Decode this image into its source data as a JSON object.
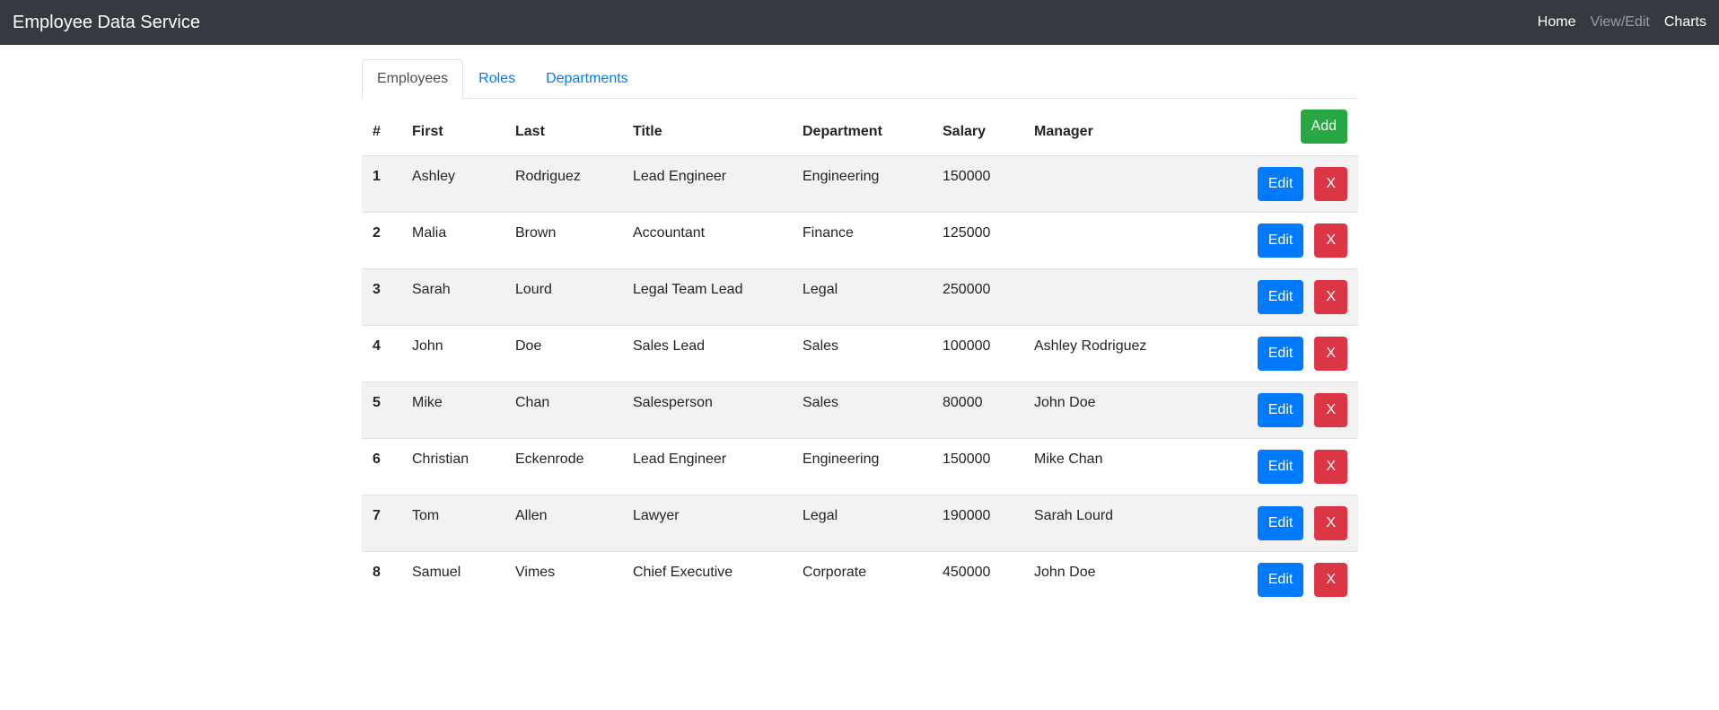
{
  "navbar": {
    "brand": "Employee Data Service",
    "links": [
      "Home",
      "View/Edit",
      "Charts"
    ]
  },
  "tabs": [
    "Employees",
    "Roles",
    "Departments"
  ],
  "table": {
    "headers": [
      "#",
      "First",
      "Last",
      "Title",
      "Department",
      "Salary",
      "Manager"
    ],
    "add_label": "Add",
    "edit_label": "Edit",
    "delete_label": "X",
    "rows": [
      [
        "1",
        "Ashley",
        "Rodriguez",
        "Lead Engineer",
        "Engineering",
        "150000",
        ""
      ],
      [
        "2",
        "Malia",
        "Brown",
        "Accountant",
        "Finance",
        "125000",
        ""
      ],
      [
        "3",
        "Sarah",
        "Lourd",
        "Legal Team Lead",
        "Legal",
        "250000",
        ""
      ],
      [
        "4",
        "John",
        "Doe",
        "Sales Lead",
        "Sales",
        "100000",
        "Ashley Rodriguez"
      ],
      [
        "5",
        "Mike",
        "Chan",
        "Salesperson",
        "Sales",
        "80000",
        "John Doe"
      ],
      [
        "6",
        "Christian",
        "Eckenrode",
        "Lead Engineer",
        "Engineering",
        "150000",
        "Mike Chan"
      ],
      [
        "7",
        "Tom",
        "Allen",
        "Lawyer",
        "Legal",
        "190000",
        "Sarah Lourd"
      ],
      [
        "8",
        "Samuel",
        "Vimes",
        "Chief Executive",
        "Corporate",
        "450000",
        "John Doe"
      ]
    ]
  }
}
